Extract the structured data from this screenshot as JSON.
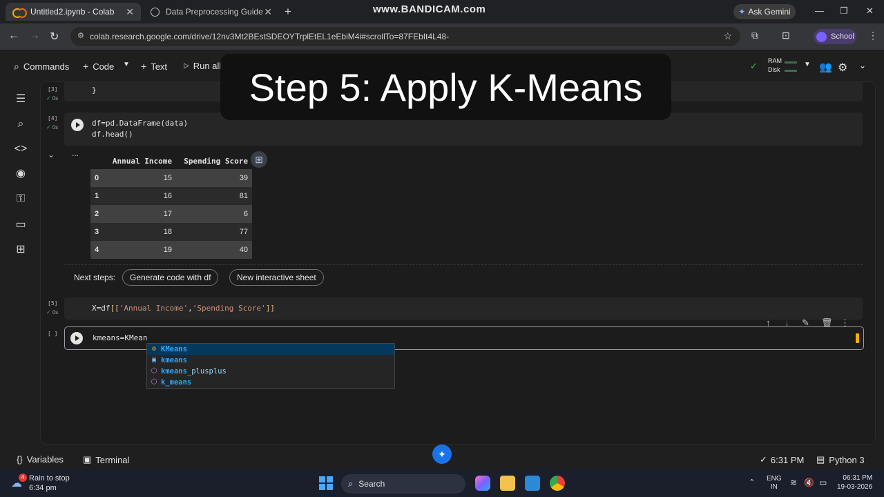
{
  "browser": {
    "tabs": [
      {
        "title": "Untitled2.ipynb - Colab",
        "active": true
      },
      {
        "title": "Data Preprocessing Guide",
        "active": false
      }
    ],
    "watermark": "www.BANDICAM.com",
    "ask_gemini": "Ask Gemini",
    "url": "colab.research.google.com/drive/12nv3Mt2BEstSDEOYTrplEtEL1eEbiM4i#scrollTo=87FEbIt4L48-",
    "profile": "School"
  },
  "toolbar": {
    "commands": "Commands",
    "code": "Code",
    "text": "Text",
    "run_all": "Run all",
    "ram": "RAM",
    "disk": "Disk"
  },
  "overlay_title": "Step 5: Apply K-Means",
  "cells": {
    "cell3": {
      "count": "[3]",
      "time": "0s",
      "code_tail": "}"
    },
    "cell4": {
      "count": "[4]",
      "time": "0s",
      "line1": "df=pd.DataFrame(data)",
      "line2": "df.head()",
      "output_more": "...",
      "table": {
        "headers": [
          "",
          "Annual Income",
          "Spending Score"
        ],
        "rows": [
          [
            "0",
            "15",
            "39"
          ],
          [
            "1",
            "16",
            "81"
          ],
          [
            "2",
            "17",
            "6"
          ],
          [
            "3",
            "18",
            "77"
          ],
          [
            "4",
            "19",
            "40"
          ]
        ]
      },
      "next_steps_label": "Next steps:",
      "next_steps": [
        "Generate code with df",
        "New interactive sheet"
      ]
    },
    "cell5": {
      "count": "[5]",
      "time": "0s",
      "prefix": "X=df",
      "open": "[[",
      "arg1": "'Annual Income'",
      "comma": ",",
      "arg2": "'Spending Score'",
      "close": "]]"
    },
    "cell6": {
      "count": "[ ]",
      "code": "kmeans=KMean"
    }
  },
  "autocomplete": [
    {
      "match": "KMeans",
      "rest": "",
      "icon": "class",
      "selected": true
    },
    {
      "match": "kmeans",
      "rest": "",
      "icon": "variable",
      "selected": false
    },
    {
      "match": "kmeans",
      "rest": "_plusplus",
      "icon": "function",
      "selected": false
    },
    {
      "match": "k_means",
      "rest": "",
      "icon": "function",
      "selected": false
    }
  ],
  "statusbar": {
    "variables": "Variables",
    "terminal": "Terminal",
    "time": "6:31 PM",
    "kernel": "Python 3"
  },
  "taskbar": {
    "weather_line1": "Rain to stop",
    "weather_line2": "6:34 pm",
    "weather_badge": "4",
    "search": "Search",
    "lang1": "ENG",
    "lang2": "IN",
    "clock_time": "06:31 PM",
    "clock_date": "19-03-2026"
  },
  "colors": {
    "accent": "#1a73e8",
    "colab_orange": "#f9ab00",
    "success": "#4caf50"
  }
}
